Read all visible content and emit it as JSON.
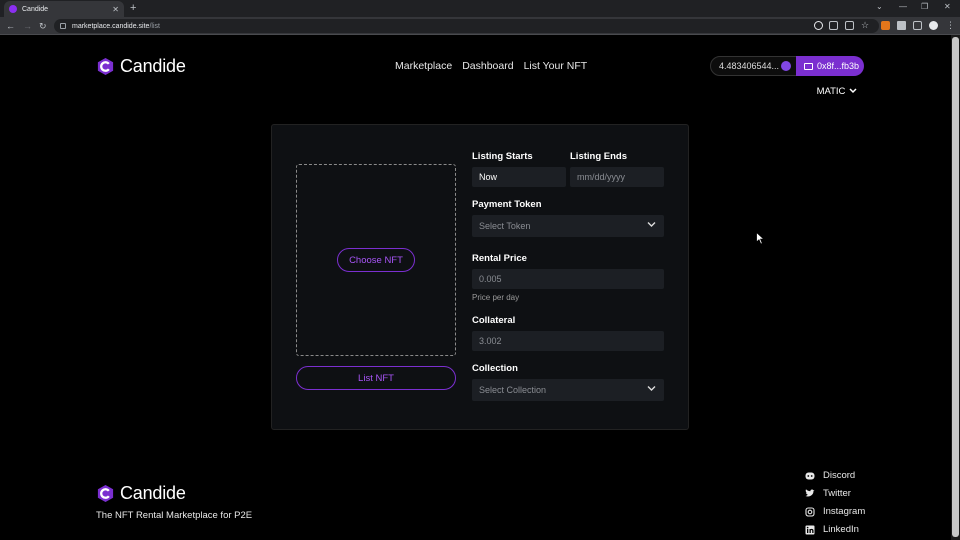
{
  "browser": {
    "tab_title": "Candide",
    "url_host": "marketplace.candide.site",
    "url_path": "/list"
  },
  "header": {
    "brand": "Candide",
    "nav": [
      "Marketplace",
      "Dashboard",
      "List Your NFT"
    ],
    "balance": "4.483406544...",
    "wallet": "0x8f...fb3b",
    "network": "MATIC"
  },
  "form": {
    "choose_nft": "Choose NFT",
    "list_nft": "List NFT",
    "listing_starts": {
      "label": "Listing Starts",
      "value": "Now"
    },
    "listing_ends": {
      "label": "Listing Ends",
      "placeholder": "mm/dd/yyyy"
    },
    "payment_token": {
      "label": "Payment Token",
      "placeholder": "Select Token"
    },
    "rental_price": {
      "label": "Rental Price",
      "placeholder": "0.005",
      "hint": "Price per day"
    },
    "collateral": {
      "label": "Collateral",
      "placeholder": "3.002"
    },
    "collection": {
      "label": "Collection",
      "placeholder": "Select Collection"
    }
  },
  "footer": {
    "brand": "Candide",
    "tagline": "The NFT Rental Marketplace for P2E",
    "social": [
      "Discord",
      "Twitter",
      "Instagram",
      "LinkedIn"
    ]
  },
  "colors": {
    "accent": "#7b2fd0",
    "accent_text": "#a855f7",
    "background": "#000000",
    "card": "#0e1013",
    "field": "#1c1f24"
  }
}
